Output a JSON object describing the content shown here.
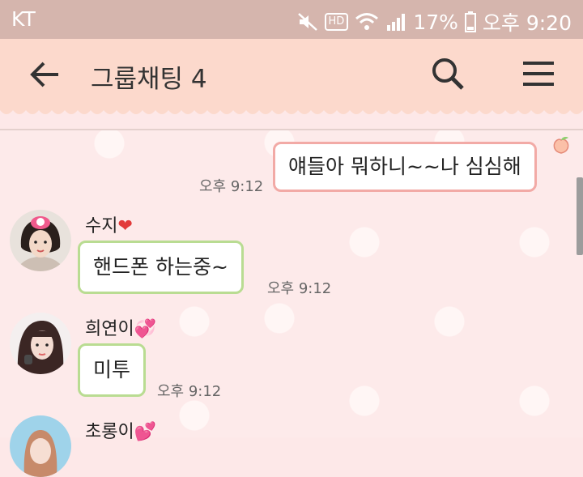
{
  "status_bar": {
    "carrier": "KT",
    "battery": "17%",
    "time": "오후 9:20",
    "hd_badge": "HD",
    "icons": [
      "mute-icon",
      "hd-voice-icon",
      "wifi-icon",
      "signal-icon",
      "battery-icon"
    ]
  },
  "header": {
    "title": "그룹채팅 4",
    "icons": [
      "back-arrow-icon",
      "search-icon",
      "menu-icon"
    ],
    "bg_color": "#fcd9cc"
  },
  "messages": [
    {
      "sender": "me",
      "text": "얘들아 뭐하니~~나 심심해",
      "time": "오후 9:12"
    },
    {
      "sender": "수지",
      "text": "핸드폰 하는중~",
      "time": "오후 9:12"
    },
    {
      "sender": "희연이",
      "text": "미투",
      "time": "오후 9:12"
    },
    {
      "sender": "초롱이",
      "text": "",
      "time": ""
    }
  ],
  "colors": {
    "my_bubble_border": "#f2aaa6",
    "their_bubble_border": "#b9dc92",
    "status_bar": "#d5b5ad"
  }
}
